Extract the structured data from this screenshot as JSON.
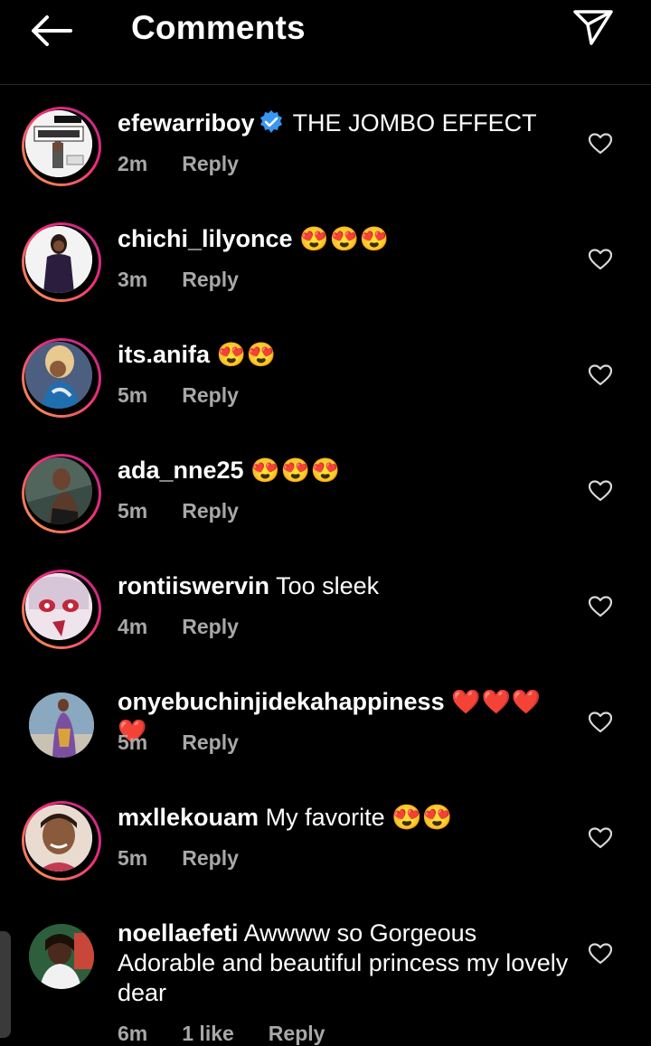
{
  "header": {
    "title": "Comments",
    "back_icon": "arrow-left-icon",
    "share_icon": "paper-plane-icon"
  },
  "comments": [
    {
      "user": "efewarriboy",
      "verified": true,
      "text": "THE JOMBO EFFECT",
      "time": "2m",
      "reply": "Reply",
      "likes": ""
    },
    {
      "user": "chichi_lilyonce",
      "verified": false,
      "text": "😍😍😍",
      "time": "3m",
      "reply": "Reply",
      "likes": ""
    },
    {
      "user": "its.anifa",
      "verified": false,
      "text": "😍😍",
      "time": "5m",
      "reply": "Reply",
      "likes": ""
    },
    {
      "user": "ada_nne25",
      "verified": false,
      "text": "😍😍😍",
      "time": "5m",
      "reply": "Reply",
      "likes": ""
    },
    {
      "user": "rontiiswervin",
      "verified": false,
      "text": "Too sleek",
      "time": "4m",
      "reply": "Reply",
      "likes": ""
    },
    {
      "user": "onyebuchinjidekahappiness",
      "verified": false,
      "text": "❤️❤️❤️❤️",
      "time": "5m",
      "reply": "Reply",
      "likes": ""
    },
    {
      "user": "mxllekouam",
      "verified": false,
      "text": "My favorite 😍😍",
      "time": "5m",
      "reply": "Reply",
      "likes": ""
    },
    {
      "user": "noellaefeti",
      "verified": false,
      "text": "Awwww so Gorgeous Adorable and beautiful princess my lovely dear",
      "time": "6m",
      "reply": "Reply",
      "likes": "1 like"
    }
  ],
  "colors": {
    "background": "#000000",
    "meta": "#a8a8a8",
    "verified": "#3897f0",
    "story_ring_start": "#f9a34a",
    "story_ring_end": "#ee2a7b"
  }
}
